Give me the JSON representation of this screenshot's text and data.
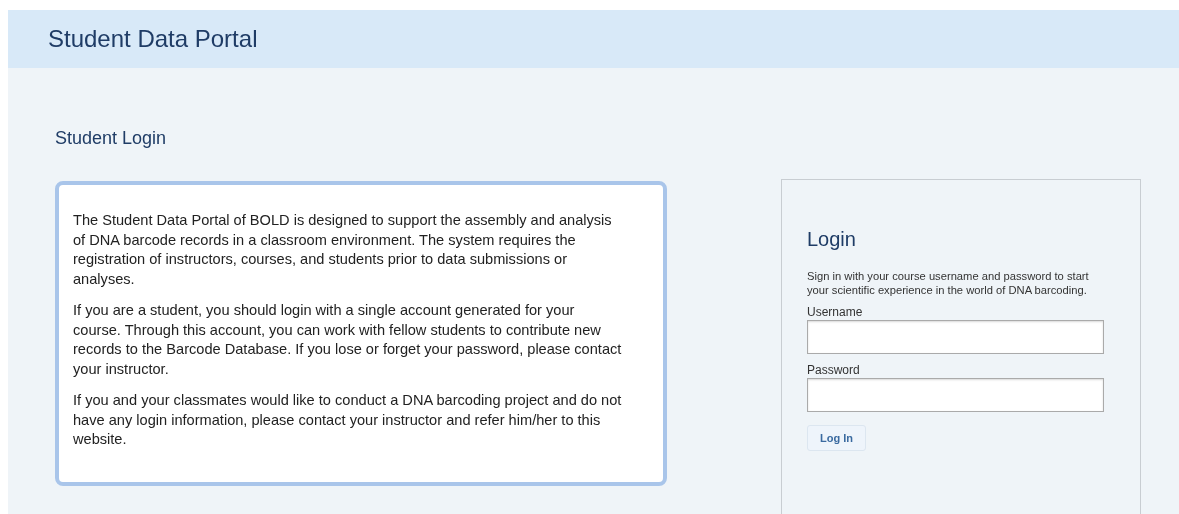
{
  "header": {
    "title": "Student Data Portal"
  },
  "section_title": "Student Login",
  "info_paragraphs": [
    "The Student Data Portal of BOLD is designed to support the assembly and analysis of DNA barcode records in a classroom environment. The system requires the registration of instructors, courses, and students prior to data submissions or analyses.",
    "If you are a student, you should login with a single account generated for your course. Through this account, you can work with fellow students to contribute new records to the Barcode Database. If you lose or forget your password, please contact your instructor.",
    "If you and your classmates would like to conduct a DNA barcoding project and do not have any login information, please contact your instructor and refer him/her to this website."
  ],
  "login": {
    "title": "Login",
    "description": "Sign in with your course username and password to start your scientific experience in the world of DNA barcoding.",
    "fields": [
      {
        "label": "Username"
      },
      {
        "label": "Password"
      }
    ],
    "button": "Log In"
  }
}
